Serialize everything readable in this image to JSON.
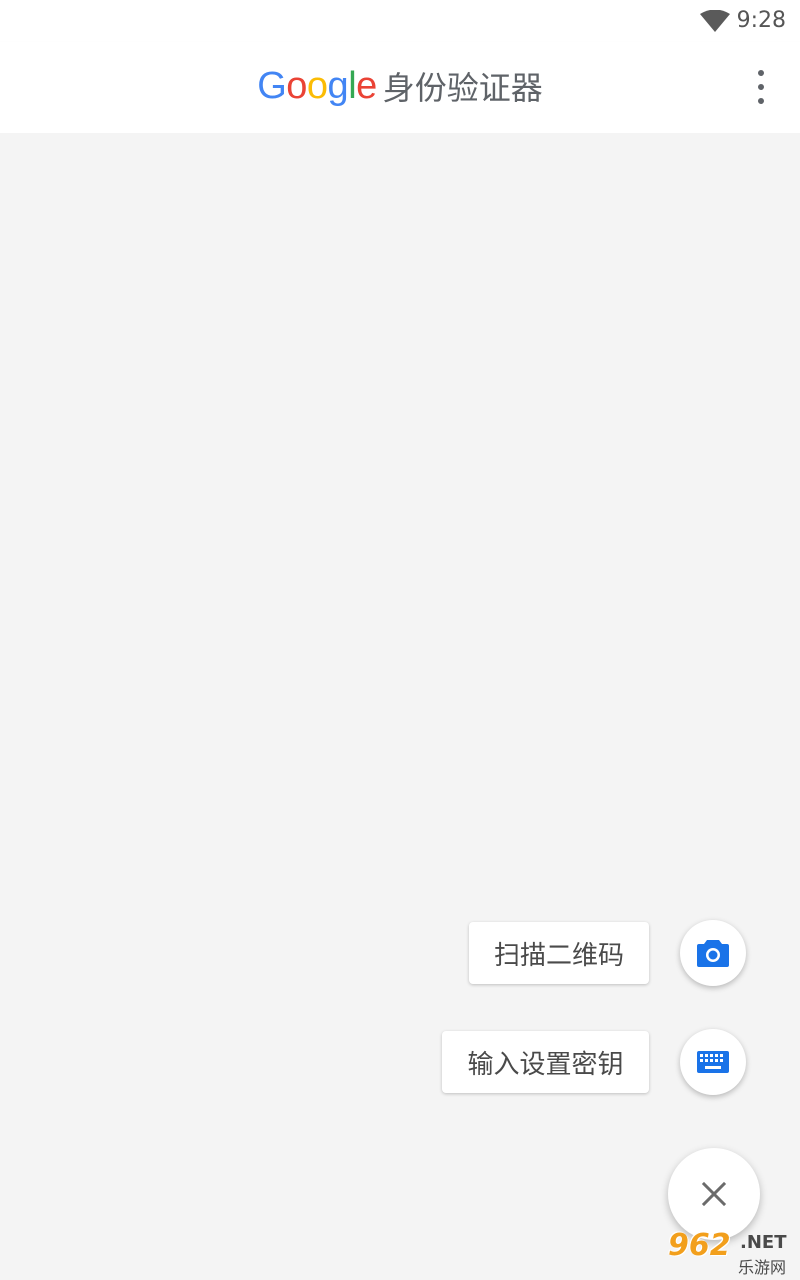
{
  "status_bar": {
    "time": "9:28",
    "wifi_icon": "wifi-icon"
  },
  "app_bar": {
    "logo_letters": [
      "G",
      "o",
      "o",
      "g",
      "l",
      "e"
    ],
    "title": "身份验证器",
    "menu_icon": "more-vert-icon"
  },
  "speed_dial": {
    "scan_label": "扫描二维码",
    "scan_icon": "camera-icon",
    "key_label": "输入设置密钥",
    "key_icon": "keyboard-icon",
    "close_icon": "close-icon"
  },
  "watermark": {
    "number": "962",
    "suffix": ".NET",
    "site": "乐游网"
  },
  "colors": {
    "accent": "#1a73e8",
    "google_blue": "#4285F4",
    "google_red": "#EA4335",
    "google_yellow": "#FBBC05",
    "google_green": "#34A853",
    "background": "#f4f4f4",
    "watermark_orange": "#f29f1c"
  }
}
